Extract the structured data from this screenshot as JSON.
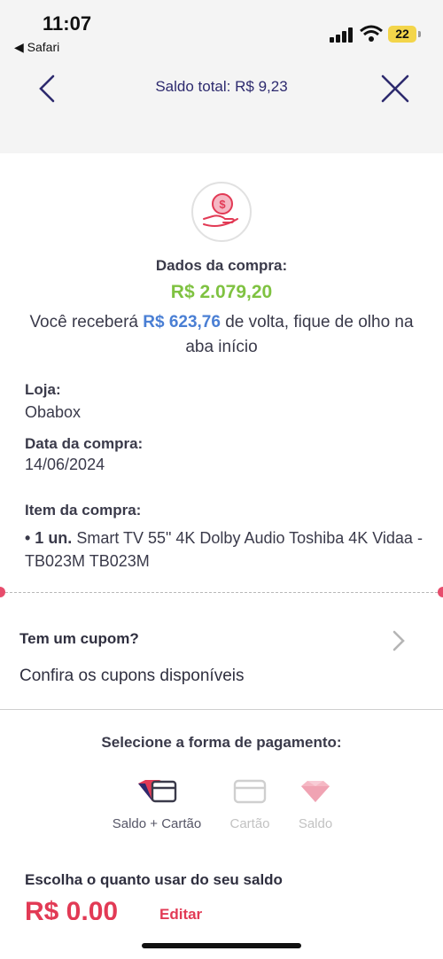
{
  "status_bar": {
    "time": "11:07",
    "back_app": "◀ Safari",
    "battery": "22"
  },
  "nav": {
    "title": "Saldo total: R$ 9,23"
  },
  "purchase": {
    "heading": "Dados da compra:",
    "amount": "R$ 2.079,20",
    "cashback_prefix": "Você receberá ",
    "cashback_amount": "R$ 623,76",
    "cashback_suffix": " de volta, fique de olho na aba início"
  },
  "details": {
    "store_label": "Loja:",
    "store_value": "Obabox",
    "date_label": "Data da compra:",
    "date_value": "14/06/2024",
    "item_label": "Item da compra:",
    "item_qty": "• 1 un.",
    "item_desc": " Smart TV 55\" 4K Dolby Audio Toshiba 4K Vidaa - TB023M TB023M"
  },
  "coupon": {
    "title": "Tem um cupom?",
    "subtitle": "Confira os cupons disponíveis"
  },
  "payment": {
    "title": "Selecione a forma de pagamento:",
    "options": [
      {
        "label": "Saldo + Cartão",
        "icon": "balance-card-icon",
        "selected": true
      },
      {
        "label": "Cartão",
        "icon": "card-icon",
        "selected": false
      },
      {
        "label": "Saldo",
        "icon": "heart-diamond-icon",
        "selected": false
      }
    ]
  },
  "balance": {
    "title": "Escolha o quanto usar do seu saldo",
    "amount": "R$ 0,00",
    "edit_label": "Editar"
  },
  "colors": {
    "accent": "#e23a55",
    "green": "#7fc241",
    "blue": "#4a7fd4",
    "navy": "#2d2a6e"
  }
}
